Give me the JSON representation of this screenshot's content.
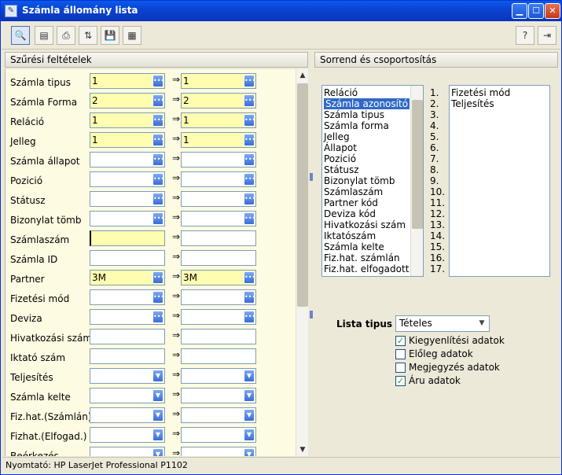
{
  "window": {
    "title": "Számla állomány lista"
  },
  "left_panel": {
    "header": "Szűrési feltételek",
    "rows": [
      {
        "label": "Számla tipus",
        "from": "1",
        "to": "1",
        "yellow": true,
        "dd": "dots"
      },
      {
        "label": "Számla Forma",
        "from": "2",
        "to": "2",
        "yellow": true,
        "dd": "dots"
      },
      {
        "label": "Reláció",
        "from": "1",
        "to": "1",
        "yellow": true,
        "dd": "dots"
      },
      {
        "label": "Jelleg",
        "from": "1",
        "to": "1",
        "yellow": true,
        "dd": "dots"
      },
      {
        "label": "Számla állapot",
        "from": "",
        "to": "",
        "yellow": false,
        "dd": "dots"
      },
      {
        "label": "Pozició",
        "from": "",
        "to": "",
        "yellow": false,
        "dd": "dots"
      },
      {
        "label": "Státusz",
        "from": "",
        "to": "",
        "yellow": false,
        "dd": "dots"
      },
      {
        "label": "Bizonylat tömb",
        "from": "",
        "to": "",
        "yellow": false,
        "dd": "dots"
      },
      {
        "label": "Számlaszám",
        "from": "",
        "to": "",
        "yellow": true,
        "dd": "none",
        "cursor": true
      },
      {
        "label": "Számla ID",
        "from": "",
        "to": "",
        "yellow": false,
        "dd": "none"
      },
      {
        "label": "Partner",
        "from": "3M",
        "to": "3M",
        "yellow": true,
        "dd": "dots"
      },
      {
        "label": "Fizetési mód",
        "from": "",
        "to": "",
        "yellow": false,
        "dd": "dots"
      },
      {
        "label": "Deviza",
        "from": "",
        "to": "",
        "yellow": false,
        "dd": "dots"
      },
      {
        "label": "Hivatkozási szám",
        "from": "",
        "to": "",
        "yellow": false,
        "dd": "none"
      },
      {
        "label": "Iktató szám",
        "from": "",
        "to": "",
        "yellow": false,
        "dd": "none"
      },
      {
        "label": "Teljesítés",
        "from": "",
        "to": "",
        "yellow": false,
        "dd": "arrow"
      },
      {
        "label": "Számla kelte",
        "from": "",
        "to": "",
        "yellow": false,
        "dd": "arrow"
      },
      {
        "label": "Fiz.hat.(Számlán)",
        "from": "",
        "to": "",
        "yellow": false,
        "dd": "arrow"
      },
      {
        "label": "Fizhat.(Elfogad.)",
        "from": "",
        "to": "",
        "yellow": false,
        "dd": "arrow"
      },
      {
        "label": "Beérkezés",
        "from": "",
        "to": "",
        "yellow": false,
        "dd": "arrow"
      }
    ],
    "arrow_glyph": "⇒"
  },
  "right_panel": {
    "header": "Sorrend és csoportosítás",
    "available": [
      "Reláció",
      "Számla azonosító",
      "Számla tipus",
      "Számla forma",
      "Jelleg",
      "Állapot",
      "Pozició",
      "Státusz",
      "Bizonylat tömb",
      "Számlaszám",
      "Partner kód",
      "Deviza kód",
      "Hivatkozási szám",
      "Iktatószám",
      "Számla kelte",
      "Fiz.hat. számlán",
      "Fiz.hat. elfogadott"
    ],
    "selected_index": 1,
    "numbers": [
      "1.",
      "2.",
      "3.",
      "4.",
      "5.",
      "6.",
      "7.",
      "8.",
      "9.",
      "10.",
      "11.",
      "12.",
      "13.",
      "14.",
      "15.",
      "16.",
      "17."
    ],
    "chosen": [
      "Fizetési mód",
      "Teljesítés"
    ],
    "lista_label": "Lista tipus",
    "lista_value": "Tételes",
    "checkboxes": [
      {
        "label": "Kiegyenlítési adatok",
        "checked": true
      },
      {
        "label": "Előleg adatok",
        "checked": false
      },
      {
        "label": "Megjegyzés adatok",
        "checked": false
      },
      {
        "label": "Áru adatok",
        "checked": true
      }
    ]
  },
  "status_bar": {
    "text": "Nyomtató: HP LaserJet Professional P1102"
  }
}
